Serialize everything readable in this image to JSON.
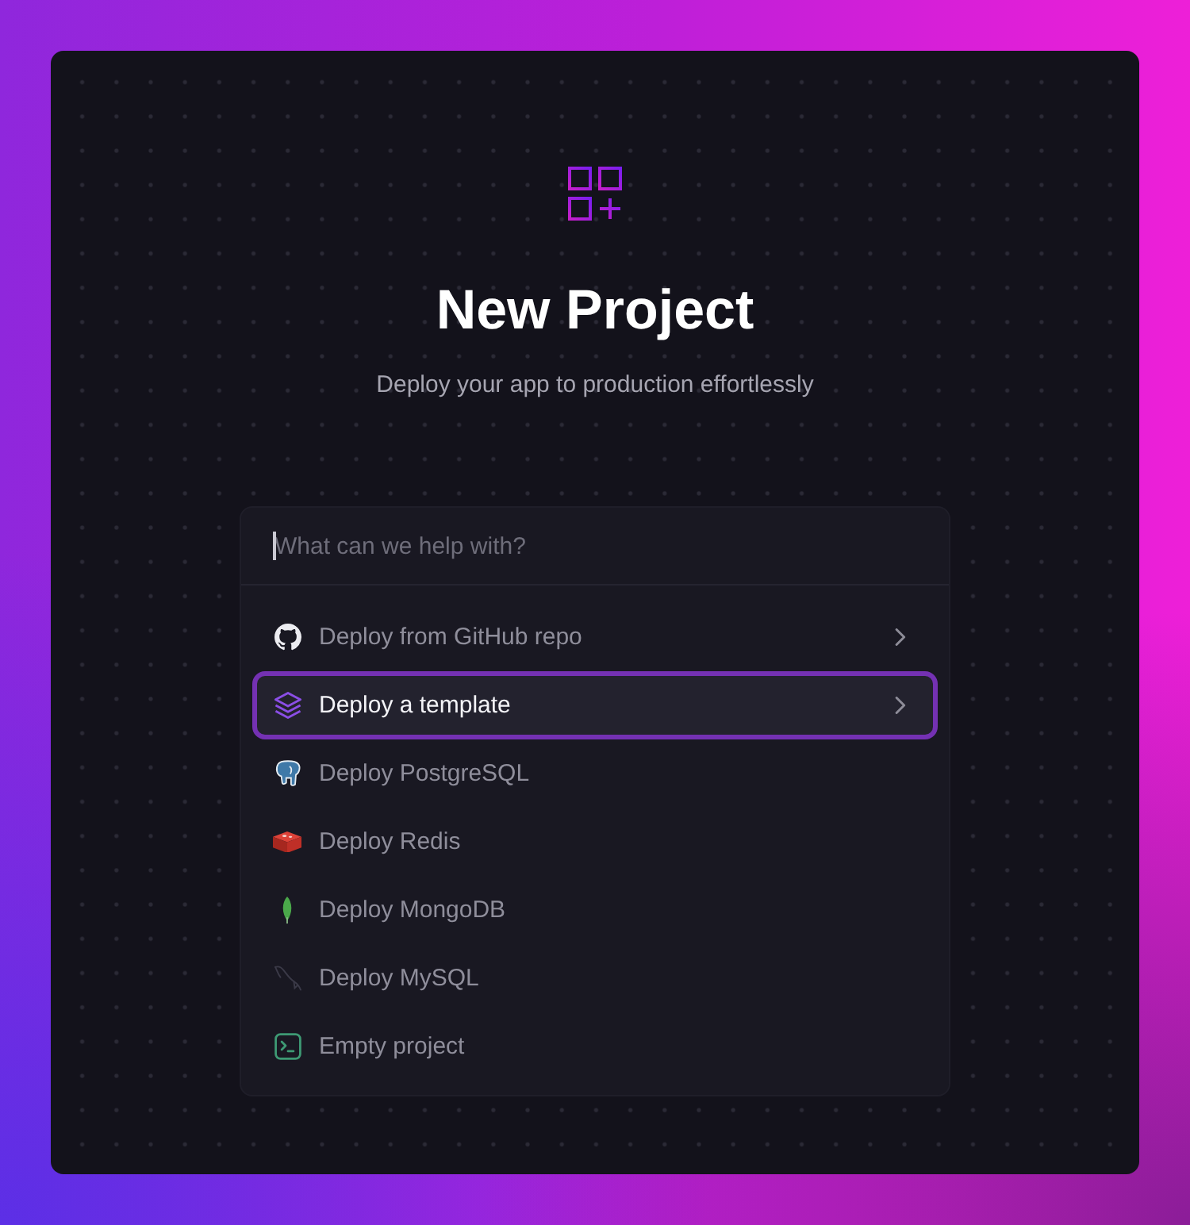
{
  "header": {
    "title": "New Project",
    "subtitle": "Deploy your app to production effortlessly"
  },
  "command_palette": {
    "search": {
      "placeholder": "What can we help with?",
      "focused": true
    },
    "items": [
      {
        "label": "Deploy from GitHub repo",
        "kind": "github",
        "has_submenu": true,
        "selected": false
      },
      {
        "label": "Deploy a template",
        "kind": "template",
        "has_submenu": true,
        "selected": true
      },
      {
        "label": "Deploy PostgreSQL",
        "kind": "postgres",
        "has_submenu": false,
        "selected": false
      },
      {
        "label": "Deploy Redis",
        "kind": "redis",
        "has_submenu": false,
        "selected": false
      },
      {
        "label": "Deploy MongoDB",
        "kind": "mongodb",
        "has_submenu": false,
        "selected": false
      },
      {
        "label": "Deploy MySQL",
        "kind": "mysql",
        "has_submenu": false,
        "selected": false
      },
      {
        "label": "Empty project",
        "kind": "empty",
        "has_submenu": false,
        "selected": false
      }
    ]
  }
}
